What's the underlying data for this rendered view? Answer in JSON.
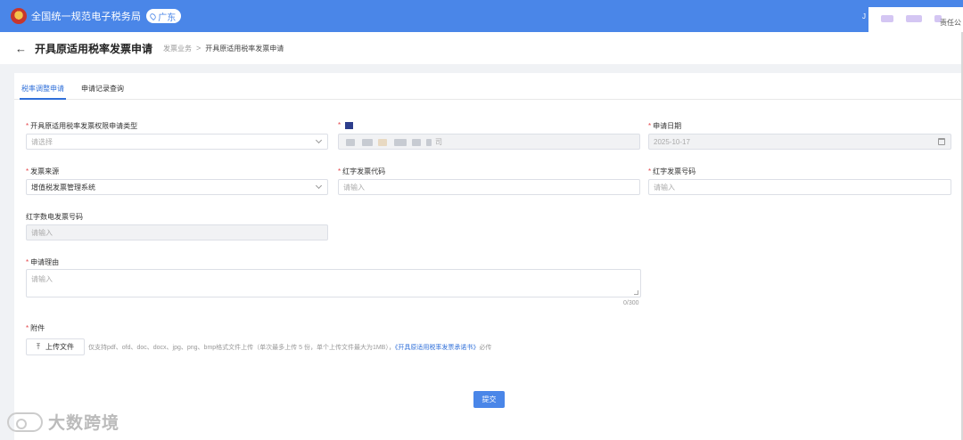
{
  "topbar": {
    "site_title": "全国统一规范电子税务局",
    "region": "广东",
    "user_suffix": "责任公",
    "user_initial": "J"
  },
  "header": {
    "title": "开具原适用税率发票申请",
    "breadcrumb_parent": "发票业务",
    "breadcrumb_sep": ">",
    "breadcrumb_current": "开具原适用税率发票申请"
  },
  "tabs": [
    {
      "label": "税率调整申请",
      "active": true
    },
    {
      "label": "申请记录查询",
      "active": false
    }
  ],
  "form": {
    "apply_type": {
      "label": "开具原适用税率发票权限申请类型",
      "required": true,
      "placeholder": "请选择"
    },
    "taxpayer": {
      "label": "",
      "required": true,
      "suffix": "司"
    },
    "apply_date": {
      "label": "申请日期",
      "required": true,
      "value": "2025-10-17"
    },
    "invoice_source": {
      "label": "发票来源",
      "required": true,
      "value": "增值税发票管理系统"
    },
    "red_invoice_code": {
      "label": "红字发票代码",
      "required": true,
      "placeholder": "请输入"
    },
    "red_invoice_no": {
      "label": "红字发票号码",
      "required": true,
      "placeholder": "请输入"
    },
    "red_digital_no": {
      "label": "红字数电发票号码",
      "required": false,
      "placeholder": "请输入"
    },
    "reason": {
      "label": "申请理由",
      "required": true,
      "placeholder": "请输入",
      "counter": "0/300"
    },
    "attachment": {
      "label": "附件",
      "required": true,
      "button_label": "上传文件",
      "hint": "仅支持pdf、ofd、doc、docx、jpg、png、bmp格式文件上传（单次最多上传 5 份，单个上传文件最大为1MB），",
      "link_text": "《开具原适用税率发票承诺书》",
      "hint_tail": "必传"
    },
    "submit_label": "提交"
  },
  "watermark": {
    "text": "大数跨境"
  },
  "colors": {
    "primary": "#4a86e8",
    "required": "#e5484d",
    "link": "#2f6fd9"
  }
}
